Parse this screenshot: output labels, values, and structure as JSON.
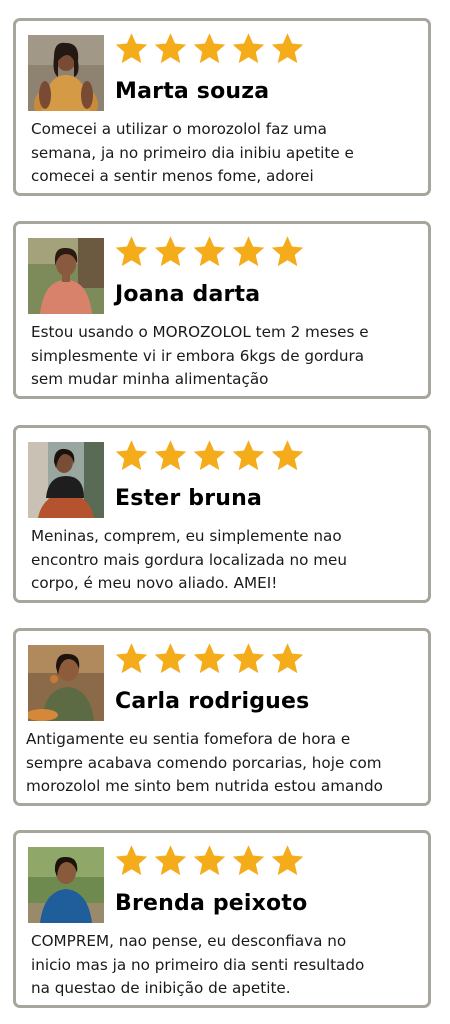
{
  "rating_color": "#f4ac1b",
  "border_color": "#a7a59c",
  "reviews": [
    {
      "name": "Marta souza",
      "stars": 5,
      "avatar_icon": "reviewer-photo",
      "lines": [
        "Comecei a utilizar o morozolol faz uma",
        "semana, ja no primeiro dia inibiu apetite e",
        "comecei a sentir menos fome, adorei"
      ]
    },
    {
      "name": "Joana darta",
      "stars": 5,
      "avatar_icon": "reviewer-photo",
      "lines": [
        "Estou usando o MOROZOLOL tem 2 meses e",
        "simplesmente vi ir embora 6kgs de gordura",
        "sem mudar minha alimentação"
      ]
    },
    {
      "name": "Ester bruna",
      "stars": 5,
      "avatar_icon": "reviewer-photo",
      "lines": [
        "Meninas, comprem, eu simplemente nao",
        "encontro mais gordura localizada no meu",
        "corpo, é meu novo aliado. AMEI!"
      ]
    },
    {
      "name": "Carla rodrigues",
      "stars": 5,
      "avatar_icon": "reviewer-photo",
      "lines": [
        "Antigamente eu sentia fomefora de hora e",
        "sempre acabava comendo porcarias, hoje com",
        "morozolol me sinto bem nutrida estou amando"
      ]
    },
    {
      "name": "Brenda peixoto",
      "stars": 5,
      "avatar_icon": "reviewer-photo",
      "lines": [
        "COMPREM, nao pense, eu desconfiava no",
        "inicio mas ja no primeiro dia senti resultado",
        "na questao de inibição de apetite."
      ]
    }
  ]
}
